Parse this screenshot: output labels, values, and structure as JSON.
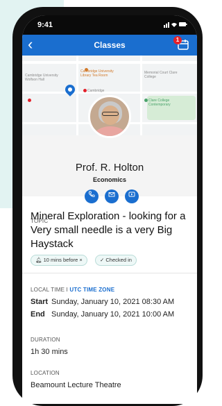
{
  "status_bar": {
    "time": "9:41",
    "icons": "signal-wifi-battery"
  },
  "nav": {
    "back_icon": "chevron-left-icon",
    "title": "Classes",
    "calendar_icon": "calendar-icon",
    "badge_count": "1"
  },
  "map": {
    "labels": [
      "Cambridge University Library Tea Room",
      "Cambridge University Wolfson Hall",
      "Memorial Court Clare College",
      "Cambridge",
      "Clare College Contemporary"
    ]
  },
  "profile": {
    "name": "Prof. R. Holton",
    "department": "Economics"
  },
  "actions": {
    "phone_icon": "phone-icon",
    "email_icon": "email-icon",
    "video_icon": "video-icon"
  },
  "topic": {
    "label": "TOPIC",
    "text": "Mineral Exploration - looking for a Very small needle is a very Big Haystack"
  },
  "chips": {
    "reminder": "10 mins before",
    "remove": "×",
    "status": "Checked in"
  },
  "local_time": {
    "label": "LOCAL TIME I ",
    "link": "UTC TIME ZONE",
    "start_label": "Start",
    "start_value": "Sunday, January 10, 2021 08:30 AM",
    "end_label": "End",
    "end_value": "Sunday, January 10, 2021 10:00 AM"
  },
  "duration": {
    "label": "DURATION",
    "value": "1h 30 mins"
  },
  "location": {
    "label": "LOCATION",
    "value": "Beamount Lecture Theatre"
  },
  "colors": {
    "accent": "#1a6ecf",
    "badge": "#e3202a",
    "chip_border": "#b9dcd8"
  }
}
